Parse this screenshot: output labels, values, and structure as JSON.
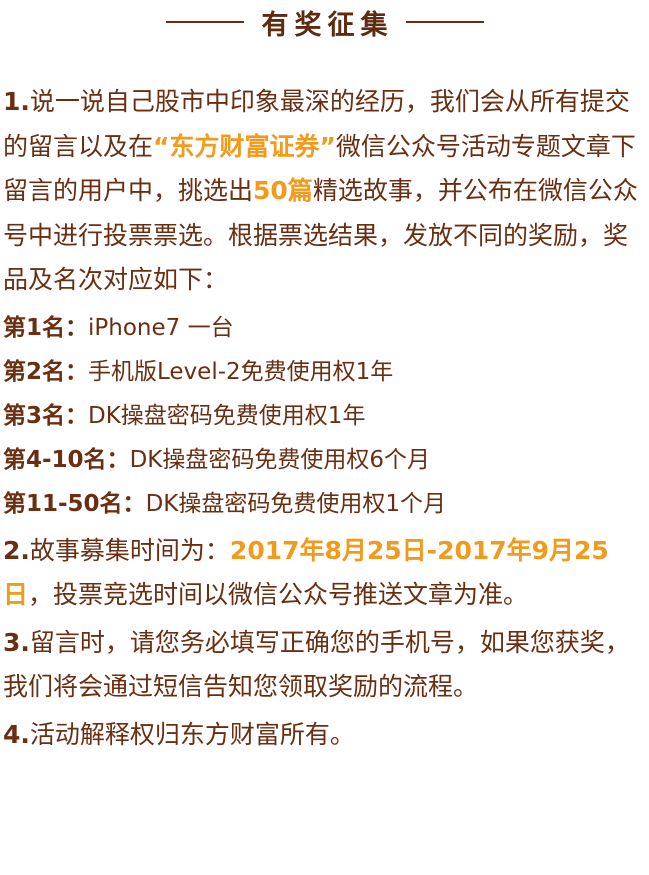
{
  "header": {
    "title": "有奖征集"
  },
  "item1": {
    "num": "1.",
    "text_a": "说一说自己股市中印象最深的经历，我们会从所有提交的留言以及在",
    "highlight_a": "“东方财富证券”",
    "text_b": "微信公众号活动专题文章下留言的用户中，挑选出",
    "highlight_b": "50篇",
    "text_c": "精选故事，并公布在微信公众号中进行投票票选。根据票选结果，发放不同的奖励，奖品及名次对应如下："
  },
  "prizes": [
    {
      "rank": "第1名：",
      "prize": "iPhone7 一台"
    },
    {
      "rank": "第2名：",
      "prize": "手机版Level-2免费使用权1年"
    },
    {
      "rank": "第3名：",
      "prize": "DK操盘密码免费使用权1年"
    },
    {
      "rank": "第4-10名：",
      "prize": "DK操盘密码免费使用权6个月"
    },
    {
      "rank": "第11-50名：",
      "prize": "DK操盘密码免费使用权1个月"
    }
  ],
  "item2": {
    "num": "2.",
    "text_a": "故事募集时间为：",
    "highlight": "2017年8月25日-2017年9月25日",
    "text_b": "，投票竞选时间以微信公众号推送文章为准。"
  },
  "item3": {
    "num": "3.",
    "text": "留言时，请您务必填写正确您的手机号，如果您获奖，我们将会通过短信告知您领取奖励的流程。"
  },
  "item4": {
    "num": "4.",
    "text": "活动解释权归东方财富所有。"
  }
}
